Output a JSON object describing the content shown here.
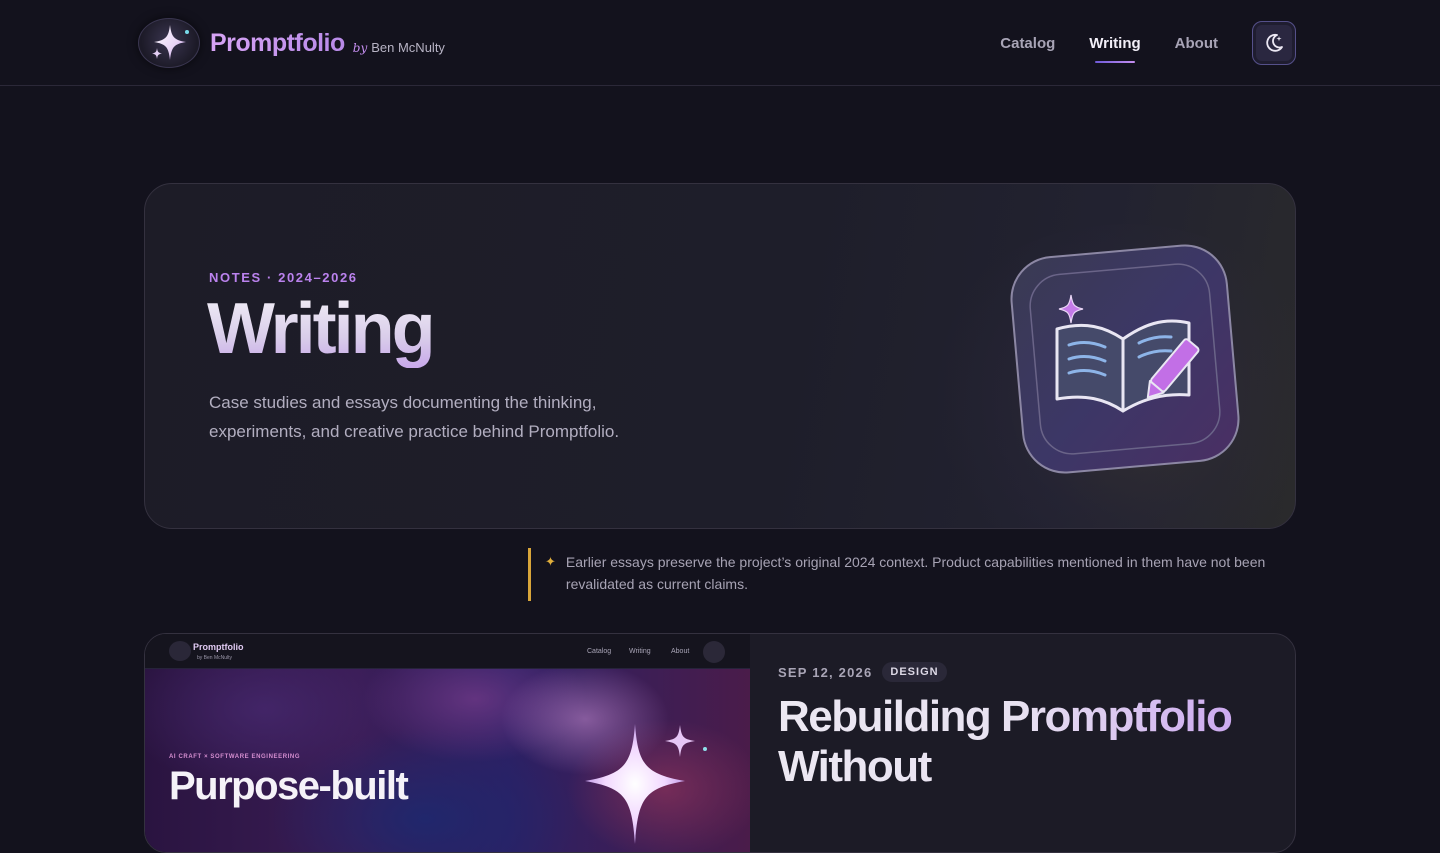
{
  "header": {
    "brand_name": "Promptfolio",
    "brand_by": "by",
    "brand_author": "Ben McNulty",
    "nav": [
      {
        "label": "Catalog",
        "active": false
      },
      {
        "label": "Writing",
        "active": true
      },
      {
        "label": "About",
        "active": false
      }
    ],
    "theme_toggle_icon": "moon-sparkle-icon"
  },
  "hero": {
    "eyebrow": "NOTES · 2024–2026",
    "title": "Writing",
    "description": "Case studies and essays documenting the thinking, experiments, and creative practice behind Promptfolio.",
    "icon": "open-book-pencil-icon"
  },
  "note": {
    "icon": "sparkle-icon",
    "text": "Earlier essays preserve the project’s original 2024 context. Product capabilities mentioned in them have not been revalidated as current claims."
  },
  "articles": [
    {
      "date": "SEP 12, 2026",
      "tag": "DESIGN",
      "title": "Rebuilding Promptfolio Without",
      "thumbnail": {
        "brand_name": "Promptfolio",
        "brand_author": "by Ben McNulty",
        "nav": [
          "Catalog",
          "Writing",
          "About"
        ],
        "eyebrow": "AI CRAFT × SOFTWARE ENGINEERING",
        "title": "Purpose-built"
      }
    }
  ],
  "colors": {
    "background": "#13121d",
    "accent": "#bb82ee",
    "note_bar": "#d8a53a"
  }
}
